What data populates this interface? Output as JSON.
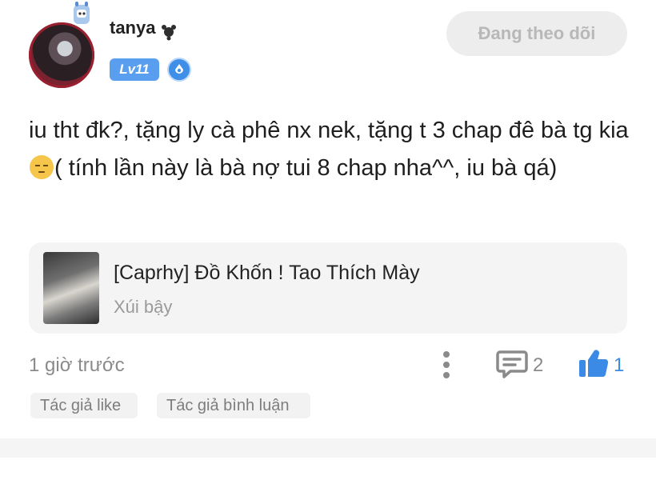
{
  "user": {
    "name": "tanya",
    "level": "Lv11",
    "follow_label": "Đang theo dõi"
  },
  "post": {
    "text_before_emoji": "iu tht đk?, tặng ly cà phê nx nek, tặng t 3 chap đê bà tg kia",
    "text_after_emoji": "( tính lần này là bà nợ tui 8 chap nha^^, iu bà qá)",
    "emoji": "pensive-emoji"
  },
  "manga": {
    "title": "[Caprhy] Đồ Khốn ! Tao Thích Mày",
    "genre": "Xúi bậy"
  },
  "footer": {
    "time": "1 giờ trước",
    "comment_count": "2",
    "like_count": "1"
  },
  "tags": [
    "Tác giả like",
    "Tác giả bình luận"
  ],
  "icons": {
    "more": "more-vertical-icon",
    "comment": "comment-icon",
    "like": "thumbs-up-icon",
    "vip": "vip-badge-icon"
  },
  "colors": {
    "accent": "#3a8ae6",
    "level_badge": "#5a9ef0",
    "muted_text": "#8a8a8a"
  }
}
